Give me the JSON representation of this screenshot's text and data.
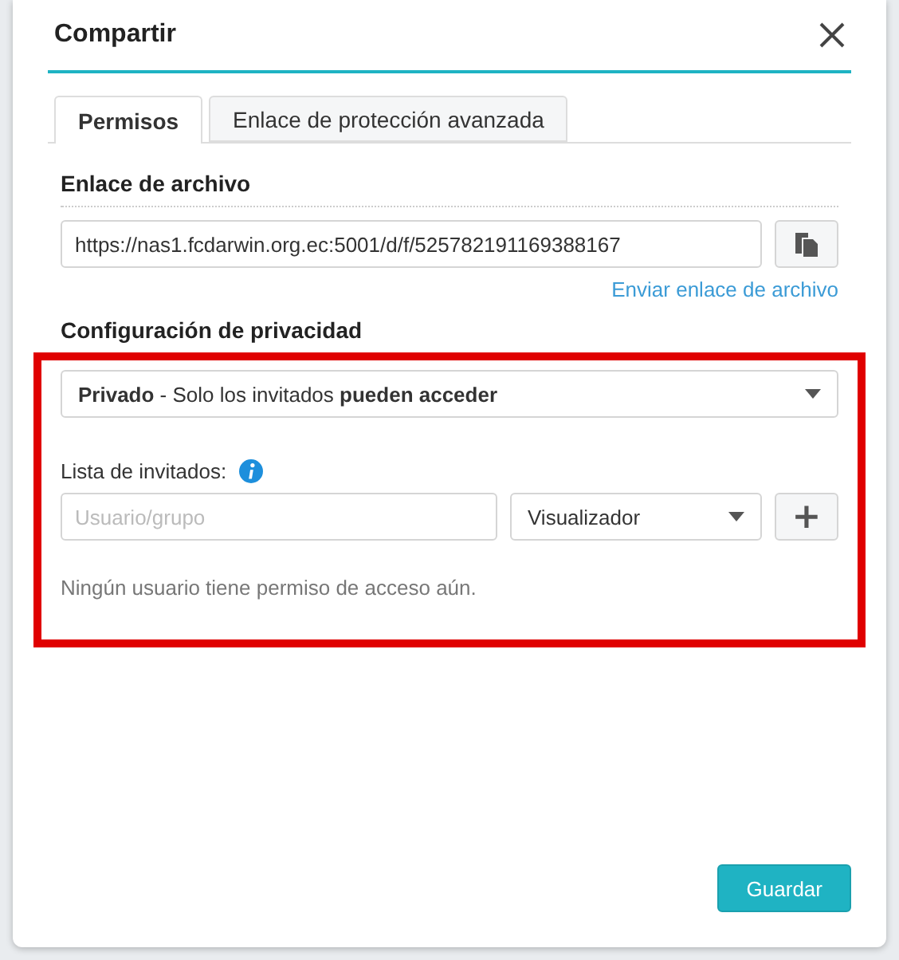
{
  "dialog": {
    "title": "Compartir"
  },
  "tabs": [
    {
      "label": "Permisos",
      "selected": true
    },
    {
      "label": "Enlace de protección avanzada",
      "selected": false
    }
  ],
  "file_link": {
    "heading": "Enlace de archivo",
    "value": "https://nas1.fcdarwin.org.ec:5001/d/f/525782191169388167",
    "send_link": "Enviar enlace de archivo"
  },
  "privacy": {
    "heading": "Configuración de privacidad",
    "option": "**Privado** - Solo los invitados **pueden acceder**",
    "highlighted": true,
    "invite_label": "Lista de invitados:",
    "user_placeholder": "Usuario/grupo",
    "role": "Visualizador",
    "add_label": "+",
    "empty_note": "Ningún usuario tiene permiso de acceso aún."
  },
  "buttons": [
    "Guardar"
  ]
}
